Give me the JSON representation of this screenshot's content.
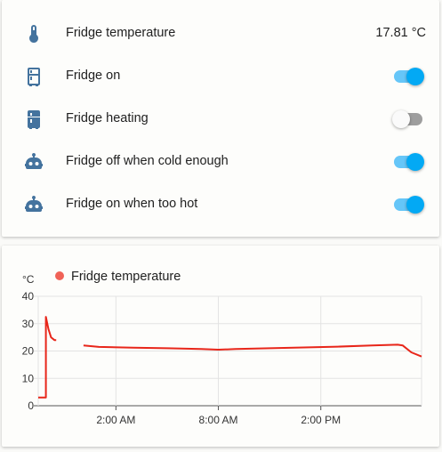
{
  "entities": [
    {
      "name": "Fridge temperature",
      "type": "sensor",
      "icon": "thermometer-icon",
      "state": "17.81 °C"
    },
    {
      "name": "Fridge on",
      "type": "switch",
      "icon": "fridge-icon",
      "on": true
    },
    {
      "name": "Fridge heating",
      "type": "switch",
      "icon": "fridge-filled-icon",
      "on": false
    },
    {
      "name": "Fridge off when cold enough",
      "type": "automation",
      "icon": "robot-icon",
      "on": true
    },
    {
      "name": "Fridge on when too hot",
      "type": "automation",
      "icon": "robot-icon",
      "on": true
    }
  ],
  "colors": {
    "accent": "#03a9f4",
    "icon": "#44739e",
    "series": "#e8261a",
    "legend_dot": "#f06257"
  },
  "chart_data": {
    "type": "line",
    "unit": "°C",
    "title": "",
    "xlabel": "",
    "ylabel": "°C",
    "ylim": [
      0,
      40
    ],
    "yticks": [
      "0",
      "10",
      "20",
      "30",
      "40"
    ],
    "x_tick_labels": [
      "2:00 AM",
      "8:00 AM",
      "2:00 PM"
    ],
    "x_range_hours": [
      -2.55,
      19.9
    ],
    "x_tick_hours": [
      2,
      8,
      14
    ],
    "grid": true,
    "legend_position": "top-left",
    "series": [
      {
        "name": "Fridge temperature",
        "segments": [
          [
            [
              -2.55,
              3
            ],
            [
              -2.1,
              3
            ],
            [
              -2.1,
              32.5
            ],
            [
              -1.95,
              28
            ],
            [
              -1.8,
              25
            ],
            [
              -1.6,
              24
            ],
            [
              -1.5,
              24
            ]
          ],
          [
            [
              0.1,
              22
            ],
            [
              1,
              21.5
            ],
            [
              3,
              21.2
            ],
            [
              5,
              21
            ],
            [
              7,
              20.7
            ],
            [
              8,
              20.5
            ],
            [
              9,
              20.7
            ],
            [
              11,
              21
            ],
            [
              13,
              21.3
            ],
            [
              15,
              21.6
            ],
            [
              17,
              22
            ],
            [
              18.5,
              22.3
            ],
            [
              18.8,
              22
            ],
            [
              19.3,
              19.5
            ],
            [
              19.9,
              18
            ]
          ]
        ]
      }
    ]
  }
}
